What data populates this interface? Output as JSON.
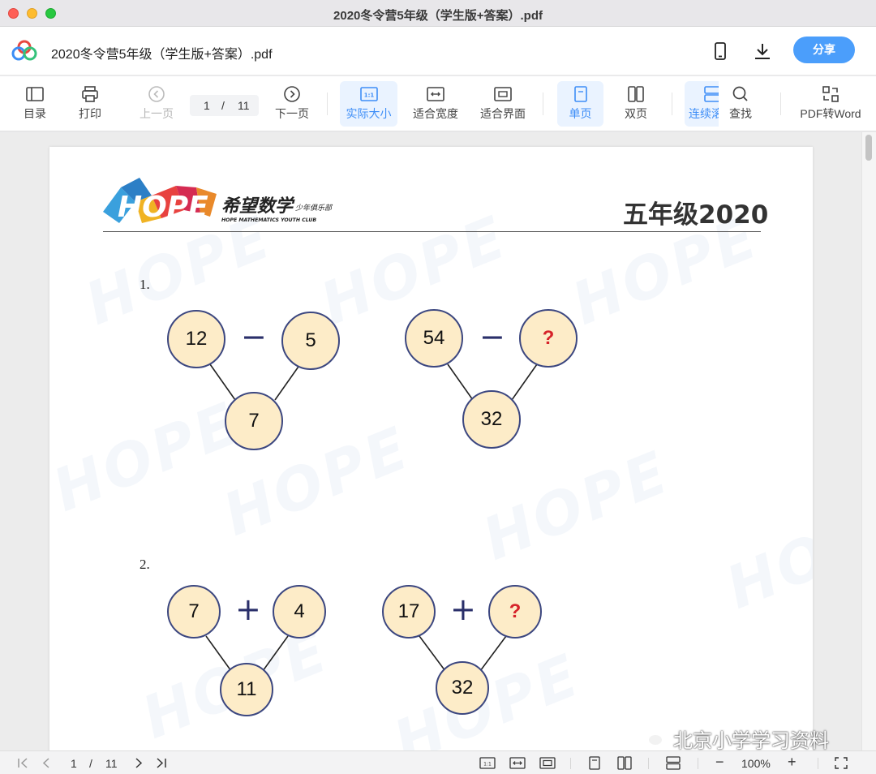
{
  "window": {
    "title": "2020冬令营5年级（学生版+答案）.pdf"
  },
  "header": {
    "doc_title": "2020冬令营5年级（学生版+答案）.pdf",
    "share_label": "分享",
    "accent": "#4b9efb"
  },
  "toolbar": {
    "toc": "目录",
    "print": "打印",
    "prev": "上一页",
    "page_current": "1",
    "page_sep": "/",
    "page_total": "11",
    "next": "下一页",
    "actual_size": "实际大小",
    "fit_width": "适合宽度",
    "fit_page": "适合界面",
    "single": "单页",
    "double": "双页",
    "continuous": "连续滚",
    "find": "查找",
    "pdf_to_word": "PDF转Word",
    "actual_size_icon": "1:1"
  },
  "document": {
    "grade_title": "五年级2020",
    "logo_text": "HOPE",
    "logo_cn": "希望数学",
    "logo_small": "少年俱乐部",
    "logo_en": "HOPE MATHEMATICS YOUTH CLUB",
    "questions": [
      {
        "num": "1.",
        "puzzles": [
          {
            "left": "12",
            "op": "−",
            "right": "5",
            "bottom": "7"
          },
          {
            "left": "54",
            "op": "−",
            "right": "?",
            "bottom": "32"
          }
        ]
      },
      {
        "num": "2.",
        "puzzles": [
          {
            "left": "7",
            "op": "+",
            "right": "4",
            "bottom": "11"
          },
          {
            "left": "17",
            "op": "+",
            "right": "?",
            "bottom": "32"
          }
        ]
      }
    ],
    "overlay_text": "北京小学学习资料"
  },
  "bottombar": {
    "page_current": "1",
    "page_sep": "/",
    "page_total": "11",
    "actual_size_icon": "1:1",
    "zoom": "100%",
    "zoom_out": "−",
    "zoom_in": "+"
  }
}
